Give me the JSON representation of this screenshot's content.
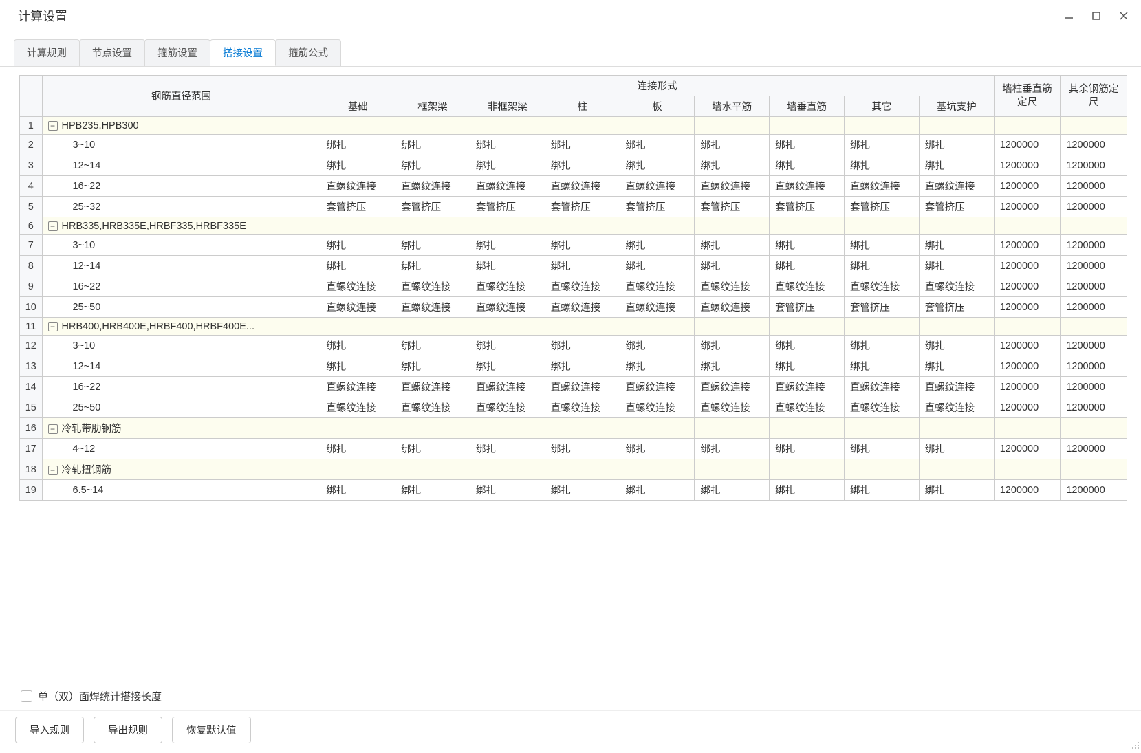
{
  "window": {
    "title": "计算设置"
  },
  "tabs": {
    "items": [
      {
        "label": "计算规则",
        "active": false
      },
      {
        "label": "节点设置",
        "active": false
      },
      {
        "label": "箍筋设置",
        "active": false
      },
      {
        "label": "搭接设置",
        "active": true
      },
      {
        "label": "箍筋公式",
        "active": false
      }
    ]
  },
  "table": {
    "header_col1": "钢筋直径范围",
    "header_conn_group": "连接形式",
    "columns": [
      "基础",
      "框架梁",
      "非框架梁",
      "柱",
      "板",
      "墙水平筋",
      "墙垂直筋",
      "其它",
      "基坑支护"
    ],
    "header_fixed1": "墙柱垂直筋定尺",
    "header_fixed2": "其余钢筋定尺",
    "rows": [
      {
        "num": "1",
        "group": true,
        "label": "HPB235,HPB300",
        "cells": [
          "",
          "",
          "",
          "",
          "",
          "",
          "",
          "",
          "",
          "",
          ""
        ]
      },
      {
        "num": "2",
        "group": false,
        "indent": 1,
        "label": "3~10",
        "cells": [
          "绑扎",
          "绑扎",
          "绑扎",
          "绑扎",
          "绑扎",
          "绑扎",
          "绑扎",
          "绑扎",
          "绑扎",
          "1200000",
          "1200000"
        ]
      },
      {
        "num": "3",
        "group": false,
        "indent": 1,
        "label": "12~14",
        "cells": [
          "绑扎",
          "绑扎",
          "绑扎",
          "绑扎",
          "绑扎",
          "绑扎",
          "绑扎",
          "绑扎",
          "绑扎",
          "1200000",
          "1200000"
        ]
      },
      {
        "num": "4",
        "group": false,
        "indent": 1,
        "label": "16~22",
        "cells": [
          "直螺纹连接",
          "直螺纹连接",
          "直螺纹连接",
          "直螺纹连接",
          "直螺纹连接",
          "直螺纹连接",
          "直螺纹连接",
          "直螺纹连接",
          "直螺纹连接",
          "1200000",
          "1200000"
        ]
      },
      {
        "num": "5",
        "group": false,
        "indent": 1,
        "label": "25~32",
        "cells": [
          "套管挤压",
          "套管挤压",
          "套管挤压",
          "套管挤压",
          "套管挤压",
          "套管挤压",
          "套管挤压",
          "套管挤压",
          "套管挤压",
          "1200000",
          "1200000"
        ]
      },
      {
        "num": "6",
        "group": true,
        "label": "HRB335,HRB335E,HRBF335,HRBF335E",
        "cells": [
          "",
          "",
          "",
          "",
          "",
          "",
          "",
          "",
          "",
          "",
          ""
        ]
      },
      {
        "num": "7",
        "group": false,
        "indent": 1,
        "label": "3~10",
        "cells": [
          "绑扎",
          "绑扎",
          "绑扎",
          "绑扎",
          "绑扎",
          "绑扎",
          "绑扎",
          "绑扎",
          "绑扎",
          "1200000",
          "1200000"
        ]
      },
      {
        "num": "8",
        "group": false,
        "indent": 1,
        "label": "12~14",
        "cells": [
          "绑扎",
          "绑扎",
          "绑扎",
          "绑扎",
          "绑扎",
          "绑扎",
          "绑扎",
          "绑扎",
          "绑扎",
          "1200000",
          "1200000"
        ]
      },
      {
        "num": "9",
        "group": false,
        "indent": 1,
        "label": "16~22",
        "cells": [
          "直螺纹连接",
          "直螺纹连接",
          "直螺纹连接",
          "直螺纹连接",
          "直螺纹连接",
          "直螺纹连接",
          "直螺纹连接",
          "直螺纹连接",
          "直螺纹连接",
          "1200000",
          "1200000"
        ]
      },
      {
        "num": "10",
        "group": false,
        "indent": 1,
        "label": "25~50",
        "cells": [
          "直螺纹连接",
          "直螺纹连接",
          "直螺纹连接",
          "直螺纹连接",
          "直螺纹连接",
          "直螺纹连接",
          "套管挤压",
          "套管挤压",
          "套管挤压",
          "1200000",
          "1200000"
        ]
      },
      {
        "num": "11",
        "group": true,
        "label": "HRB400,HRB400E,HRBF400,HRBF400E...",
        "cells": [
          "",
          "",
          "",
          "",
          "",
          "",
          "",
          "",
          "",
          "",
          ""
        ]
      },
      {
        "num": "12",
        "group": false,
        "indent": 1,
        "label": "3~10",
        "cells": [
          "绑扎",
          "绑扎",
          "绑扎",
          "绑扎",
          "绑扎",
          "绑扎",
          "绑扎",
          "绑扎",
          "绑扎",
          "1200000",
          "1200000"
        ]
      },
      {
        "num": "13",
        "group": false,
        "indent": 1,
        "label": "12~14",
        "cells": [
          "绑扎",
          "绑扎",
          "绑扎",
          "绑扎",
          "绑扎",
          "绑扎",
          "绑扎",
          "绑扎",
          "绑扎",
          "1200000",
          "1200000"
        ]
      },
      {
        "num": "14",
        "group": false,
        "indent": 1,
        "label": "16~22",
        "cells": [
          "直螺纹连接",
          "直螺纹连接",
          "直螺纹连接",
          "直螺纹连接",
          "直螺纹连接",
          "直螺纹连接",
          "直螺纹连接",
          "直螺纹连接",
          "直螺纹连接",
          "1200000",
          "1200000"
        ]
      },
      {
        "num": "15",
        "group": false,
        "indent": 1,
        "label": "25~50",
        "cells": [
          "直螺纹连接",
          "直螺纹连接",
          "直螺纹连接",
          "直螺纹连接",
          "直螺纹连接",
          "直螺纹连接",
          "直螺纹连接",
          "直螺纹连接",
          "直螺纹连接",
          "1200000",
          "1200000"
        ]
      },
      {
        "num": "16",
        "group": true,
        "label": "冷轧带肋钢筋",
        "cells": [
          "",
          "",
          "",
          "",
          "",
          "",
          "",
          "",
          "",
          "",
          ""
        ]
      },
      {
        "num": "17",
        "group": false,
        "indent": 1,
        "label": "4~12",
        "cells": [
          "绑扎",
          "绑扎",
          "绑扎",
          "绑扎",
          "绑扎",
          "绑扎",
          "绑扎",
          "绑扎",
          "绑扎",
          "1200000",
          "1200000"
        ]
      },
      {
        "num": "18",
        "group": true,
        "label": "冷轧扭钢筋",
        "cells": [
          "",
          "",
          "",
          "",
          "",
          "",
          "",
          "",
          "",
          "",
          ""
        ]
      },
      {
        "num": "19",
        "group": false,
        "indent": 1,
        "label": "6.5~14",
        "cells": [
          "绑扎",
          "绑扎",
          "绑扎",
          "绑扎",
          "绑扎",
          "绑扎",
          "绑扎",
          "绑扎",
          "绑扎",
          "1200000",
          "1200000"
        ]
      }
    ]
  },
  "footer": {
    "checkbox_label": "单（双）面焊统计搭接长度",
    "buttons": {
      "import": "导入规则",
      "export": "导出规则",
      "restore": "恢复默认值"
    }
  }
}
